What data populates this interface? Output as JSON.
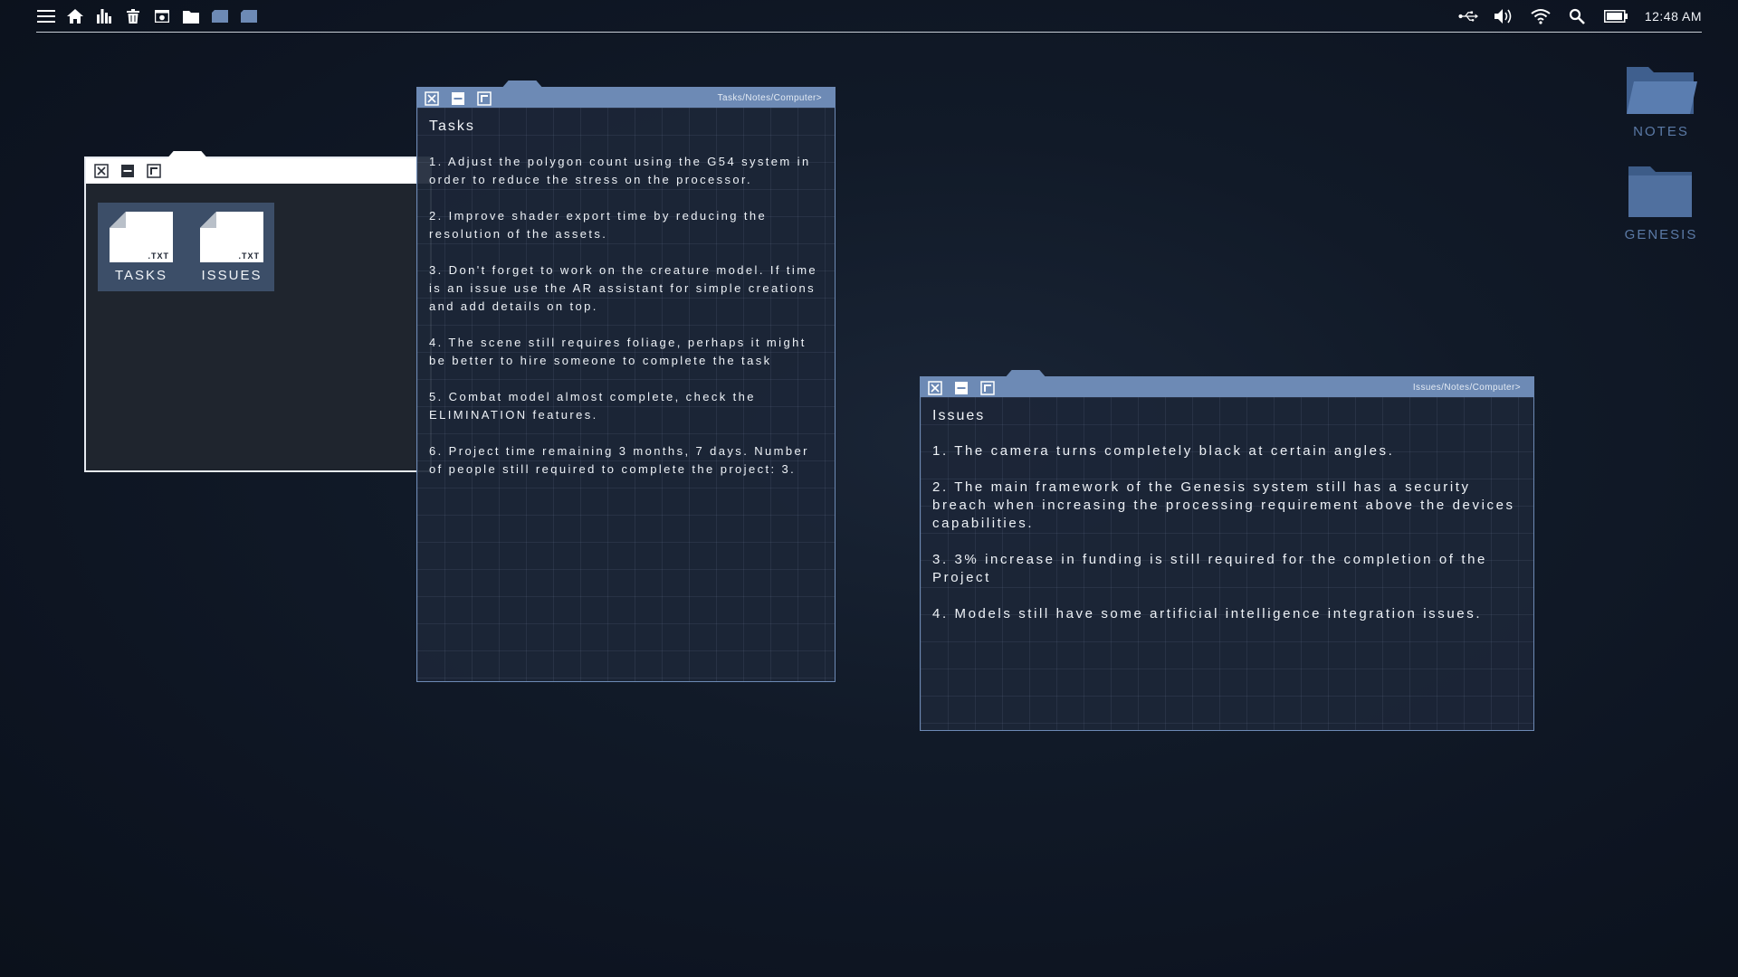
{
  "topbar": {
    "left_icons": [
      "menu-icon",
      "home-icon",
      "stats-icon",
      "trash-icon",
      "picture-icon",
      "folder-icon",
      "folder-tab-icon",
      "folder-tab-icon"
    ],
    "right_icons": [
      "usb-icon",
      "volume-icon",
      "wifi-icon",
      "search-icon",
      "battery-icon"
    ],
    "clock": "12:48 AM"
  },
  "file_window": {
    "files": [
      {
        "ext": ".TXT",
        "label": "TASKS"
      },
      {
        "ext": ".TXT",
        "label": "ISSUES"
      }
    ]
  },
  "tasks_window": {
    "path": "Tasks/Notes/Computer>",
    "title": "Tasks",
    "items": [
      "1. Adjust the polygon count using the G54 system in order to reduce the stress on the processor.",
      "2. Improve shader export time by reducing the resolution of the assets.",
      "3. Don't forget to work on the creature model. If time is an issue use the AR assistant for simple creations and add details on top.",
      "4. The scene still requires foliage, perhaps it might be better to hire someone to complete the task",
      "5. Combat model almost complete, check the ELIMINATION features.",
      "6. Project time remaining 3 months, 7 days. Number of people still required to complete the project: 3."
    ]
  },
  "issues_window": {
    "path": "Issues/Notes/Computer>",
    "title": "Issues",
    "items": [
      "1. The camera turns completely black at certain angles.",
      "2. The main framework of the Genesis system still has a security breach when increasing the processing requirement above the devices capabilities.",
      "3. 3% increase in funding is still required for the completion of the Project",
      "4.  Models still have some artificial intelligence integration issues."
    ]
  },
  "desktop": {
    "folders": [
      {
        "label": "NOTES"
      },
      {
        "label": "GENESIS"
      }
    ]
  },
  "colors": {
    "window_chrome": "#6d8ab5",
    "grid_body": "#1c2637",
    "folder_blue": "#4d6f9e",
    "folder_label": "#5b7aa6"
  }
}
